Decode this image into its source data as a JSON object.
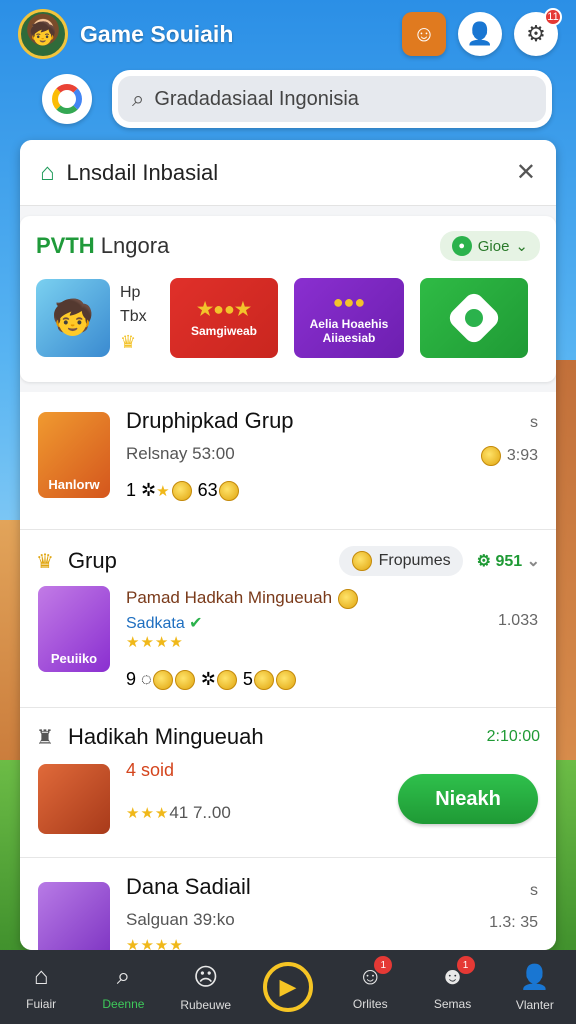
{
  "header": {
    "app_title": "Game Souiaih",
    "notification_count": "11"
  },
  "search": {
    "value": "Gradadasiaal Ingonisia"
  },
  "banner": {
    "title": "Lnsdail Inbasial"
  },
  "featured": {
    "title_prefix": "PVTH",
    "title_rest": " Lngora",
    "pill_label": "Gioe",
    "meta_line1": "Hp",
    "meta_line2": "Tbx",
    "tile_red_label": "Samgiweab",
    "tile_purple_label": "Aelia Hoaehis\nAiiaesiab"
  },
  "items": [
    {
      "title": "Druphipkad Grup",
      "subtitle": "Relsnay 53:00",
      "right_top": "s",
      "right_value": "3:93",
      "stats": "1",
      "stats2": "63",
      "art_label": "Hanlorw"
    },
    {
      "title": "Grup",
      "chip_label": "Fropumes",
      "right_chip": "951",
      "line1": "Pamad Hadkah Mingueuah",
      "line2": "Sadkata",
      "right_value": "1.033",
      "stats": "9",
      "stats2": "5",
      "art_label": "Peuiiko"
    },
    {
      "title": "Hadikah Mingueuah",
      "right_value": "2:10:00",
      "line1": "4 soid",
      "rating_text": "41 7..00",
      "button_label": "Nieakh"
    },
    {
      "title": "Dana Sadiail",
      "subtitle": "Salguan 39:ko",
      "right_top": "s",
      "right_value": "1.3: 35"
    }
  ],
  "nav": [
    {
      "label": "Fuiair",
      "icon": "home-icon"
    },
    {
      "label": "Deenne",
      "icon": "search-icon"
    },
    {
      "label": "Rubeuwe",
      "icon": "face-icon"
    },
    {
      "label": "",
      "icon": "play-icon"
    },
    {
      "label": "Orlites",
      "icon": "chat-icon",
      "badge": "1"
    },
    {
      "label": "Semas",
      "icon": "person-icon",
      "badge": "1"
    },
    {
      "label": "Vlanter",
      "icon": "user-icon"
    }
  ],
  "colors": {
    "accent_green": "#2bb24c",
    "nav_bg": "#2d3138",
    "badge_red": "#e53935",
    "play_yellow": "#f6c524"
  }
}
